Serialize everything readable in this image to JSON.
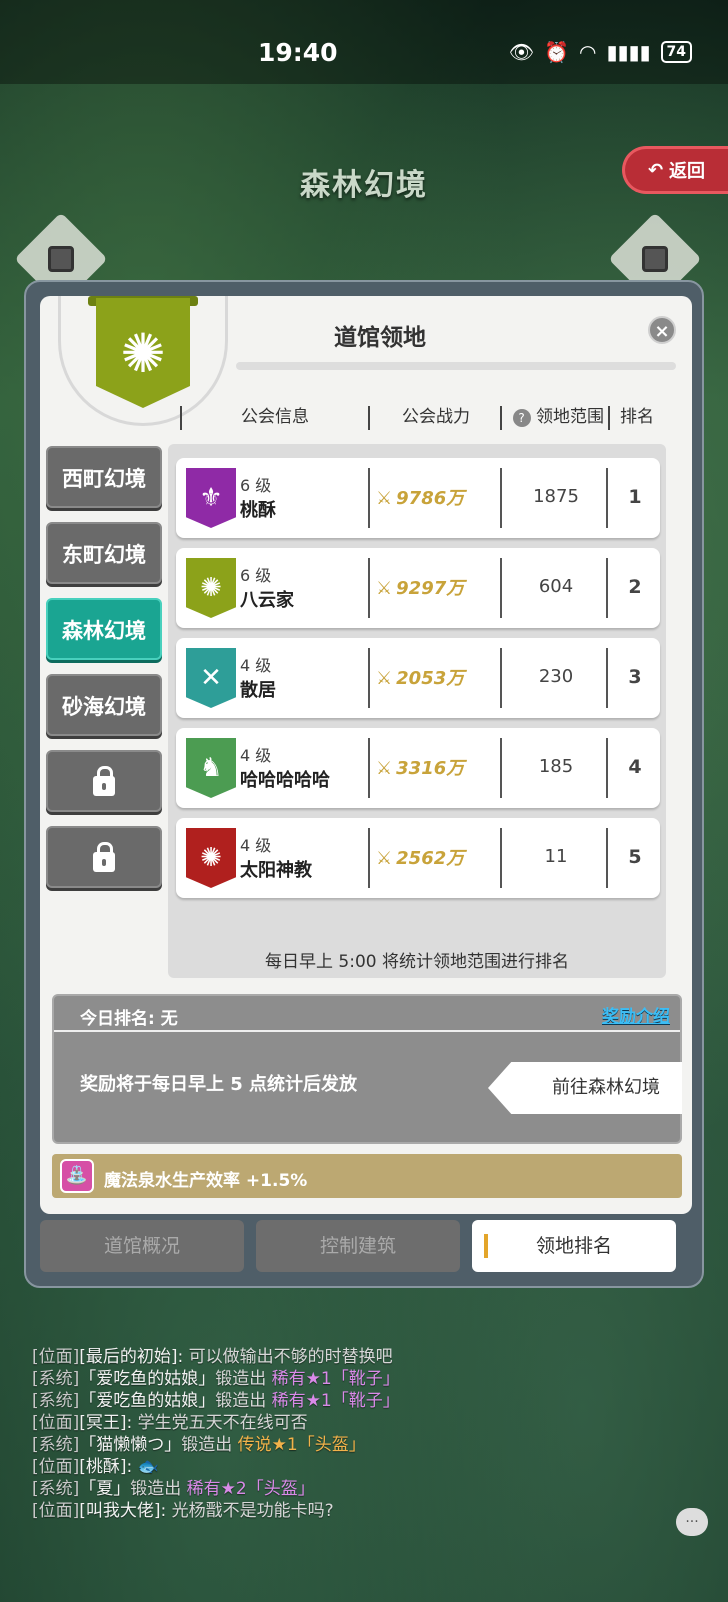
{
  "status": {
    "time": "19:40",
    "battery": "74"
  },
  "map": {
    "region_title": "森林幻境",
    "back_label": "返回"
  },
  "panel": {
    "title": "道馆领地",
    "close": "×",
    "columns": {
      "guild_info": "公会信息",
      "guild_power": "公会战力",
      "territory": "领地范围",
      "rank": "排名"
    },
    "side_tabs": [
      {
        "label": "西町幻境"
      },
      {
        "label": "东町幻境"
      },
      {
        "label": "森林幻境"
      },
      {
        "label": "砂海幻境"
      }
    ],
    "rows": [
      {
        "level": "6 级",
        "name": "桃酥",
        "power": "9786万",
        "range": "1875",
        "rank": "1",
        "color": "#8f2aa6",
        "icon": "fleur-de-lis-icon"
      },
      {
        "level": "6 级",
        "name": "八云家",
        "power": "9297万",
        "range": "604",
        "rank": "2",
        "color": "#8ca21a",
        "icon": "sun-icon"
      },
      {
        "level": "4 级",
        "name": "散居",
        "power": "2053万",
        "range": "230",
        "rank": "3",
        "color": "#2e9e98",
        "icon": "crossed-swords-icon"
      },
      {
        "level": "4 级",
        "name": "哈哈哈哈哈",
        "power": "3316万",
        "range": "185",
        "rank": "4",
        "color": "#4c9c52",
        "icon": "chess-knight-icon"
      },
      {
        "level": "4 级",
        "name": "太阳神教",
        "power": "2562万",
        "range": "11",
        "rank": "5",
        "color": "#b0201e",
        "icon": "sun-icon"
      }
    ],
    "rank_note": "每日早上 5:00 将统计领地范围进行排名",
    "today_rank": "今日排名: 无",
    "reward_intro": "奖励介绍",
    "reward_desc": "奖励将于每日早上 5 点统计后发放",
    "goto_label": "前往森林幻境",
    "buff": "魔法泉水生产效率 +1.5%",
    "bottom_tabs": [
      {
        "label": "道馆概况"
      },
      {
        "label": "控制建筑"
      },
      {
        "label": "领地排名"
      }
    ]
  },
  "chat": [
    {
      "ch": "[位面]",
      "nm": "[最后的初始]:",
      "msg": " 可以做输出不够的时替换吧"
    },
    {
      "ch": "[系统]",
      "nm": "「爱吃鱼的姑娘」",
      "msg": "锻造出 ",
      "item": "稀有★1「靴子」",
      "kind": "rare"
    },
    {
      "ch": "[系统]",
      "nm": "「爱吃鱼的姑娘」",
      "msg": "锻造出 ",
      "item": "稀有★1「靴子」",
      "kind": "rare"
    },
    {
      "ch": "[位面]",
      "nm": "[冥王]:",
      "msg": " 学生党五天不在线可否"
    },
    {
      "ch": "[系统]",
      "nm": "「猫懒懒つ」",
      "msg": "锻造出 ",
      "item": "传说★1「头盔」",
      "kind": "legend"
    },
    {
      "ch": "[位面]",
      "nm": "[桃酥]:",
      "msg": " 🐟"
    },
    {
      "ch": "[系统]",
      "nm": "「夏」",
      "msg": "锻造出 ",
      "item": "稀有★2「头盔」",
      "kind": "rare"
    },
    {
      "ch": "[位面]",
      "nm": "[叫我大佬]:",
      "msg": " 光杨戬不是功能卡吗?"
    }
  ],
  "colors": {
    "active_tab": "#1aa592",
    "power_gold": "#c8a33a",
    "reward_link": "#3bbdf5",
    "back_red": "#b92d36"
  }
}
